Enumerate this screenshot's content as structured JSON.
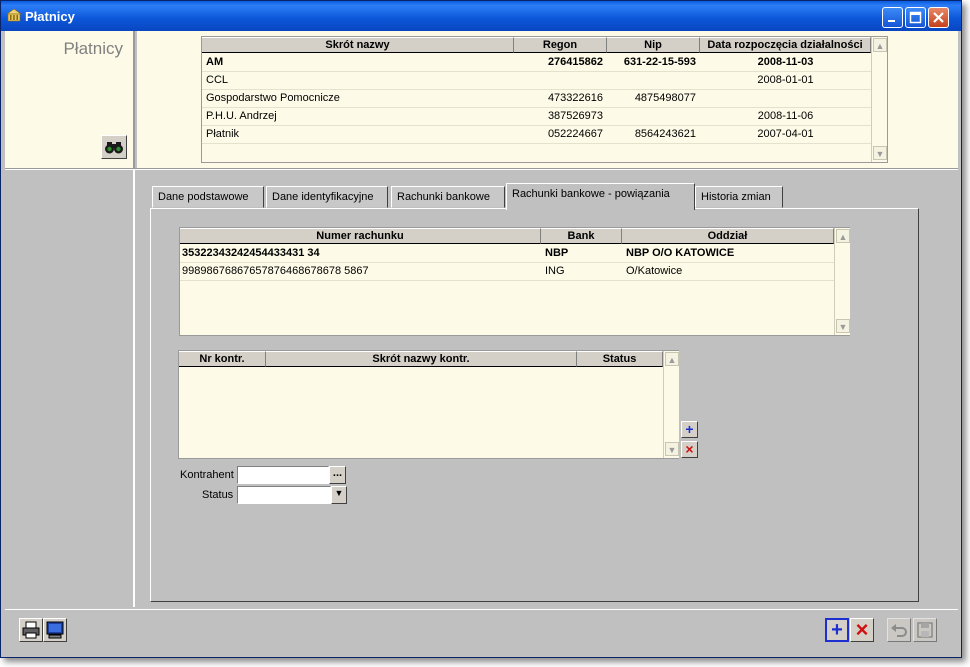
{
  "window": {
    "title": "Płatnicy",
    "colors": {
      "titlebar": "#0a5ce0",
      "panel": "#fdfbe8",
      "background": "#c0c0c0"
    }
  },
  "sidebar": {
    "title": "Płatnicy",
    "search_icon": "binoculars-icon"
  },
  "payers_table": {
    "columns": [
      "Skrót nazwy",
      "Regon",
      "Nip",
      "Data rozpoczęcia działalności"
    ],
    "rows": [
      {
        "name": "AM",
        "regon": "276415862",
        "nip": "631-22-15-593",
        "date": "2008-11-03"
      },
      {
        "name": "CCL",
        "regon": "",
        "nip": "",
        "date": "2008-01-01"
      },
      {
        "name": "Gospodarstwo Pomocnicze",
        "regon": "473322616",
        "nip": "4875498077",
        "date": ""
      },
      {
        "name": "P.H.U. Andrzej",
        "regon": "387526973",
        "nip": "",
        "date": "2008-11-06"
      },
      {
        "name": "Płatnik",
        "regon": "052224667",
        "nip": "8564243621",
        "date": "2007-04-01"
      }
    ]
  },
  "tabs": [
    {
      "label": "Dane podstawowe"
    },
    {
      "label": "Dane identyfikacyjne"
    },
    {
      "label": "Rachunki bankowe"
    },
    {
      "label": "Rachunki bankowe - powiązania"
    },
    {
      "label": "Historia zmian"
    }
  ],
  "accounts_table": {
    "columns": [
      "Numer rachunku",
      "Bank",
      "Oddział"
    ],
    "rows": [
      {
        "number": "35322343242454433431 34",
        "bank": "NBP",
        "branch": "NBP O/O KATOWICE"
      },
      {
        "number": "99898676867657876468678678 5867",
        "bank": "ING",
        "branch": "O/Katowice"
      }
    ]
  },
  "contractors_table": {
    "columns": [
      "Nr kontr.",
      "Skrót nazwy kontr.",
      "Status"
    ],
    "rows": []
  },
  "form": {
    "contractor_label": "Kontrahent",
    "contractor_value": "",
    "browse_label": "...",
    "status_label": "Status",
    "status_value": ""
  },
  "row_actions": {
    "add": "+",
    "delete": "×"
  },
  "toolbar": {
    "add": "+",
    "delete": "×"
  }
}
